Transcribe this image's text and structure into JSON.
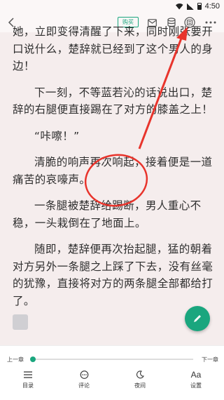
{
  "status_bar": {
    "time": "4:50"
  },
  "toolbar": {
    "buy_label": "购买"
  },
  "content": {
    "paragraphs": [
      "她，立即变得清醒了下来，同时刚张要开口说什么，楚辞就已经到了这个男人的身边！",
      "下一刻，不等蓝若沁的话说出口，楚辞的右腿便直接踢在了对方的膝盖之上！",
      "“咔嚓！”",
      "清脆的响声再次响起，接着便是一道痛苦的哀嚎声。",
      "一条腿被楚辞给踢断，男人重心不稳，一头栽倒在了地面上。",
      "随即，楚辞便再次抬起腿，猛的朝着对方另外一条腿之上踩了下去，没有丝毫的犹豫，直接将对方的两条腿全部都给打了。"
    ]
  },
  "reader_controls": {
    "prev_chapter": "上一章",
    "next_chapter": "下一章",
    "progress": 0.0,
    "nav": [
      {
        "label": "目录",
        "icon": "list-icon"
      },
      {
        "label": "评论",
        "icon": "comment-icon"
      },
      {
        "label": "夜间",
        "icon": "moon-icon"
      },
      {
        "label": "设置",
        "icon": "font-settings-icon"
      }
    ]
  },
  "colors": {
    "accent": "#1aa67e",
    "annotation": "#e8342c",
    "page_bg": "#f5eded"
  }
}
